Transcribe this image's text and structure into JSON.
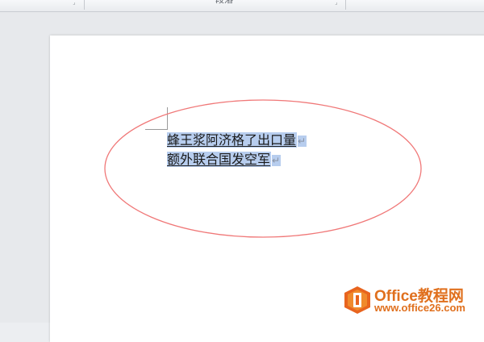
{
  "ribbon": {
    "group_label": "段落",
    "launcher_glyph": "⌟"
  },
  "document": {
    "lines": [
      {
        "text": "蜂王浆阿济格了出口量",
        "mark": "↵"
      },
      {
        "text": "额外联合国发空军",
        "mark": "↵"
      }
    ]
  },
  "annotation": {
    "ellipse_color": "#f07878"
  },
  "watermark": {
    "title": "Office教程网",
    "url": "www.office26.com",
    "color": "#e0701e"
  },
  "colors": {
    "selection": "#b7cdee",
    "page": "#ffffff",
    "background": "#e7e9ec"
  }
}
